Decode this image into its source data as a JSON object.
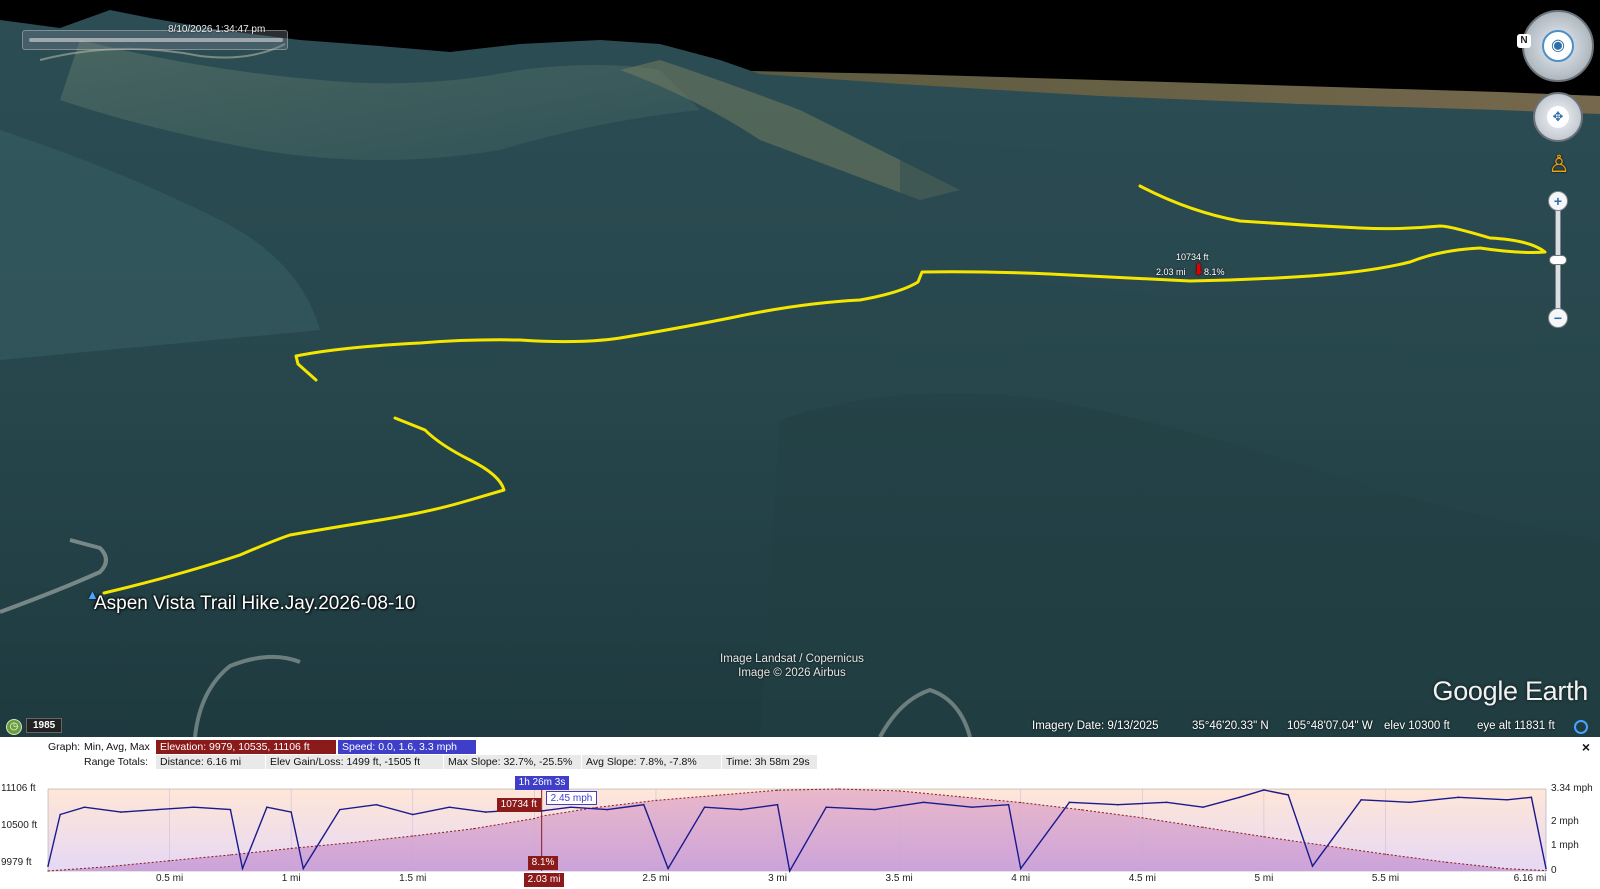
{
  "viewport": {
    "timestamp": "8/10/2026   1:34:47 pm",
    "placemark_name": "Aspen Vista Trail Hike.Jay.2026-08-10",
    "cursor": {
      "elevation": "10734 ft",
      "distance": "2.03 mi",
      "slope": "8.1%"
    },
    "attribution": [
      "Image Landsat / Copernicus",
      "Image © 2026 Airbus"
    ],
    "brand": "Google Earth",
    "history_year": "1985",
    "north_label": "N",
    "colors": {
      "track": "#f5e600",
      "cursor_marker": "#e00000",
      "forest_dark": "#1f3a40",
      "forest_mid": "#2e5258",
      "sky": "#000000"
    }
  },
  "status_bar": {
    "imagery_date": "Imagery Date: 9/13/2025",
    "latitude": "35°46'20.33\" N",
    "longitude": "105°48'07.04\" W",
    "elevation": "elev 10300 ft",
    "eye_alt": "eye alt  11831 ft"
  },
  "profile": {
    "graph_label": "Graph:",
    "graph_values_label": "Min, Avg, Max",
    "elevation_stats": "Elevation: 9979, 10535, 11106 ft",
    "speed_stats": "Speed: 0.0, 1.6, 3.3 mph",
    "totals_label": "Range Totals:",
    "distance": "Distance: 6.16 mi",
    "elev_gain_loss": "Elev Gain/Loss: 1499 ft, -1505 ft",
    "max_slope": "Max Slope: 32.7%, -25.5%",
    "avg_slope": "Avg Slope: 7.8%, -7.8%",
    "time": "Time: 3h 58m 29s",
    "close_label": "×",
    "cursor_tags": {
      "time": "1h 26m 3s",
      "elevation": "10734 ft",
      "speed": "2.45 mph",
      "slope": "8.1%",
      "distance": "2.03 mi"
    }
  },
  "chart_data": {
    "type": "area",
    "title": "",
    "xlabel": "",
    "ylabel": "",
    "x_ticks": [
      "0.5 mi",
      "1 mi",
      "1.5 mi",
      "2 mi",
      "2.5 mi",
      "3 mi",
      "3.5 mi",
      "4 mi",
      "4.5 mi",
      "5 mi",
      "5.5 mi",
      "6.16 mi"
    ],
    "x_tick_values": [
      0.5,
      1,
      1.5,
      2,
      2.5,
      3,
      3.5,
      4,
      4.5,
      5,
      5.5,
      6.16
    ],
    "xlim": [
      0,
      6.16
    ],
    "y_left_ticks": [
      "11106 ft",
      "10500 ft",
      "9979 ft"
    ],
    "ylim_left": [
      9979,
      11106
    ],
    "y_right_ticks": [
      "3.34 mph",
      "2 mph",
      "1 mph",
      "0"
    ],
    "ylim_right": [
      0,
      3.34
    ],
    "cursor_x": 2.03,
    "series": [
      {
        "name": "Elevation",
        "unit": "ft",
        "color": "#d98ca8",
        "x": [
          0,
          0.25,
          0.5,
          0.75,
          1,
          1.25,
          1.5,
          1.75,
          2,
          2.03,
          2.25,
          2.5,
          2.75,
          3,
          3.25,
          3.5,
          3.75,
          4,
          4.25,
          4.5,
          4.75,
          5,
          5.25,
          5.5,
          5.75,
          6,
          6.16
        ],
        "values": [
          9979,
          10040,
          10120,
          10200,
          10290,
          10370,
          10460,
          10560,
          10700,
          10734,
          10850,
          10950,
          11020,
          11090,
          11106,
          11080,
          11000,
          10920,
          10820,
          10710,
          10580,
          10450,
          10330,
          10210,
          10100,
          10010,
          9985
        ]
      },
      {
        "name": "Speed",
        "unit": "mph",
        "color": "#1a1a8c",
        "x": [
          0,
          0.05,
          0.15,
          0.3,
          0.45,
          0.6,
          0.75,
          0.8,
          0.9,
          1.0,
          1.05,
          1.2,
          1.35,
          1.5,
          1.65,
          1.8,
          1.95,
          2.03,
          2.15,
          2.3,
          2.45,
          2.55,
          2.7,
          2.85,
          3.0,
          3.05,
          3.2,
          3.4,
          3.6,
          3.8,
          3.95,
          4.0,
          4.2,
          4.4,
          4.6,
          4.75,
          4.9,
          5.0,
          5.1,
          5.2,
          5.4,
          5.6,
          5.8,
          6.0,
          6.1,
          6.16
        ],
        "values": [
          0.2,
          2.3,
          2.6,
          2.4,
          2.5,
          2.6,
          2.5,
          0.1,
          2.6,
          2.4,
          0.1,
          2.5,
          2.7,
          2.3,
          2.6,
          2.4,
          2.5,
          2.45,
          2.6,
          2.5,
          2.7,
          0.1,
          2.6,
          2.5,
          2.7,
          0.0,
          2.6,
          2.5,
          2.8,
          2.6,
          2.7,
          0.1,
          2.8,
          2.7,
          2.8,
          2.6,
          3.0,
          3.3,
          3.1,
          0.2,
          2.9,
          2.8,
          3.0,
          2.9,
          3.0,
          0.1
        ]
      }
    ]
  }
}
